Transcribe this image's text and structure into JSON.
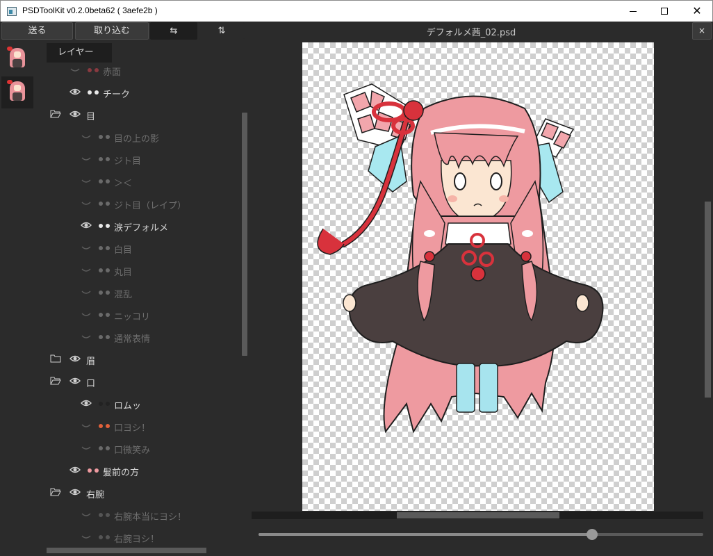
{
  "window": {
    "title": "PSDToolKit v0.2.0beta62 ( 3aefe2b )",
    "minimize_glyph": "",
    "close_glyph": "✕"
  },
  "toolbar": {
    "send_label": "送る",
    "import_label": "取り込む",
    "swap_h_glyph": "⇆",
    "swap_v_glyph": "⇅",
    "close_doc_glyph": "×"
  },
  "document": {
    "title": "デフォルメ茜_02.psd",
    "zoom_fraction": 0.75
  },
  "panel": {
    "tab_label": "レイヤー"
  },
  "layers": [
    {
      "name": "赤面",
      "visible": false,
      "folder": false,
      "indent": 1,
      "dim": true,
      "icon": "blush-thumb"
    },
    {
      "name": "チーク",
      "visible": true,
      "folder": false,
      "indent": 1,
      "dim": false,
      "icon": "cheek-thumb"
    },
    {
      "name": "目",
      "visible": true,
      "folder": true,
      "open": true,
      "indent": 0,
      "dim": false
    },
    {
      "name": "目の上の影",
      "visible": false,
      "folder": false,
      "indent": 2,
      "dim": true,
      "icon": "eye-shadow-thumb"
    },
    {
      "name": "ジト目",
      "visible": false,
      "folder": false,
      "indent": 2,
      "dim": true,
      "icon": "jito-eye-thumb"
    },
    {
      "name": "＞＜",
      "visible": false,
      "folder": false,
      "indent": 2,
      "dim": true,
      "icon": "squint-eye-thumb"
    },
    {
      "name": "ジト目（レイプ）",
      "visible": false,
      "folder": false,
      "indent": 2,
      "dim": true,
      "icon": "jito-eye-2-thumb"
    },
    {
      "name": "涙デフォルメ",
      "visible": true,
      "folder": false,
      "indent": 2,
      "dim": false,
      "icon": "tear-eye-thumb"
    },
    {
      "name": "白目",
      "visible": false,
      "folder": false,
      "indent": 2,
      "dim": true,
      "icon": "white-eye-thumb"
    },
    {
      "name": "丸目",
      "visible": false,
      "folder": false,
      "indent": 2,
      "dim": true,
      "icon": "round-eye-thumb"
    },
    {
      "name": "混乱",
      "visible": false,
      "folder": false,
      "indent": 2,
      "dim": true,
      "icon": "confused-eye-thumb"
    },
    {
      "name": "ニッコリ",
      "visible": false,
      "folder": false,
      "indent": 2,
      "dim": true,
      "icon": "smile-eye-thumb"
    },
    {
      "name": "通常表情",
      "visible": false,
      "folder": false,
      "indent": 2,
      "dim": true,
      "icon": "normal-eye-thumb"
    },
    {
      "name": "眉",
      "visible": true,
      "folder": true,
      "open": false,
      "indent": 0,
      "dim": false
    },
    {
      "name": "口",
      "visible": true,
      "folder": true,
      "open": true,
      "indent": 0,
      "dim": false
    },
    {
      "name": "ロムッ",
      "visible": true,
      "folder": false,
      "indent": 2,
      "dim": false,
      "icon": "pout-mouth-thumb"
    },
    {
      "name": "口ヨシ！",
      "visible": false,
      "folder": false,
      "indent": 2,
      "dim": true,
      "icon": "open-mouth-thumb"
    },
    {
      "name": "口微笑み",
      "visible": false,
      "folder": false,
      "indent": 2,
      "dim": true,
      "icon": "smile-mouth-thumb"
    },
    {
      "name": "髪前の方",
      "visible": true,
      "folder": false,
      "indent": 1,
      "dim": false,
      "icon": "front-hair-thumb"
    },
    {
      "name": "右腕",
      "visible": true,
      "folder": true,
      "open": true,
      "indent": 0,
      "dim": false
    },
    {
      "name": "右腕本当にヨシ！",
      "visible": false,
      "folder": false,
      "indent": 2,
      "dim": true,
      "icon": "arm-thumb"
    },
    {
      "name": "右腕ヨシ！",
      "visible": false,
      "folder": false,
      "indent": 2,
      "dim": true,
      "icon": "arm-thumb"
    }
  ],
  "colors": {
    "hair": "#ee9aa0",
    "hair_dark": "#c96f78",
    "ribbon_red": "#d8323c",
    "ribbon_blue": "#a8e8f0",
    "dress": "#4a3f3f",
    "skin": "#fbe6d2",
    "sock": "#a7e4ee"
  }
}
